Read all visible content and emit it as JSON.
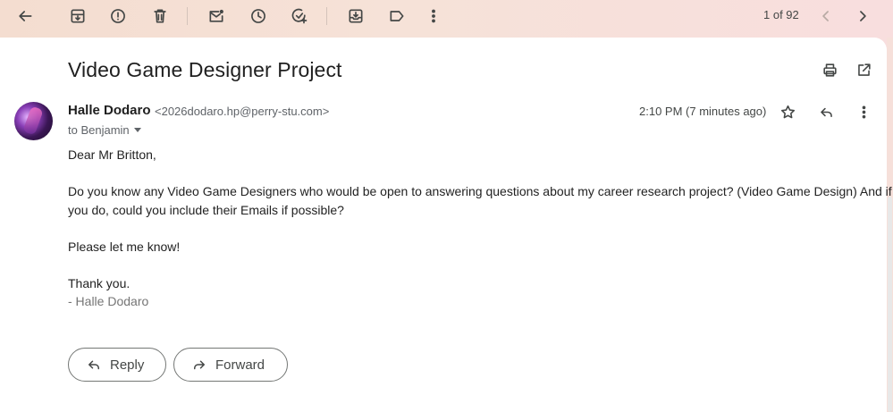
{
  "toolbar": {
    "icons": [
      "back-arrow-icon",
      "archive-icon",
      "report-spam-icon",
      "delete-icon",
      "mark-unread-icon",
      "snooze-icon",
      "add-task-icon",
      "move-to-icon",
      "label-icon",
      "more-vert-icon"
    ],
    "pager": "1 of 92"
  },
  "message": {
    "subject": "Video Game Designer Project",
    "sender_name": "Halle Dodaro",
    "sender_email": "<2026dodaro.hp@perry-stu.com>",
    "to": "to Benjamin",
    "time": "2:10 PM (7 minutes ago)",
    "greeting": "Dear Mr Britton,",
    "paragraph1_line1": "Do you know any Video Game Designers who would be open to answering questions about my career research project? (Video Game Design) And if",
    "paragraph1_line2": "you do, could you include their Emails if possible?",
    "paragraph2": "Please let me know!",
    "closing": "Thank you.",
    "signature": "- Halle Dodaro"
  },
  "actions": {
    "reply_label": "Reply",
    "forward_label": "Forward"
  }
}
